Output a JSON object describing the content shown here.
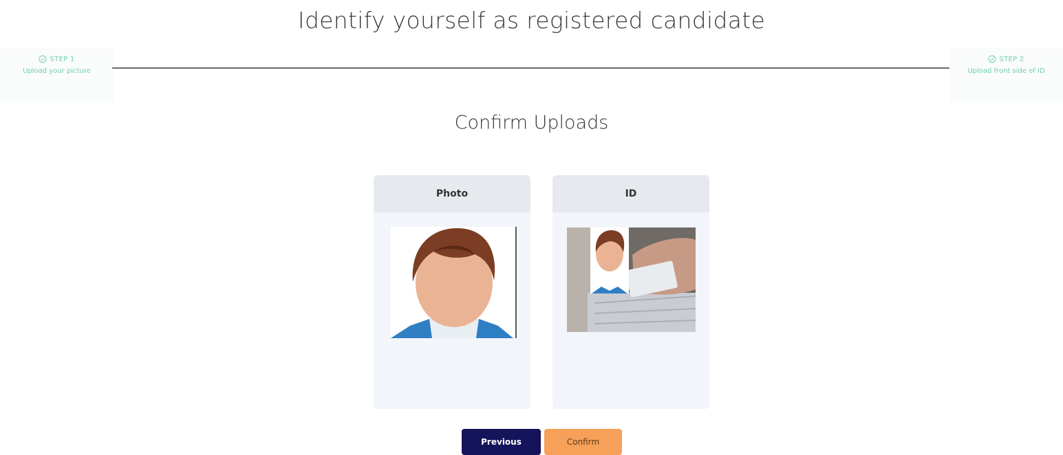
{
  "page": {
    "title": "Identify yourself as registered candidate"
  },
  "steps": [
    {
      "label": "STEP 1",
      "description": "Upload your picture",
      "status": "completed"
    },
    {
      "label": "STEP 2",
      "description": "Upload front side of ID",
      "status": "completed"
    }
  ],
  "confirm": {
    "title": "Confirm Uploads",
    "cards": [
      {
        "header": "Photo",
        "image": "avatar-placeholder"
      },
      {
        "header": "ID",
        "image": "id-card-photo"
      }
    ]
  },
  "actions": {
    "previous_label": "Previous",
    "confirm_label": "Confirm"
  },
  "colors": {
    "step_accent": "#6fcfb0",
    "previous_button": "#15135a",
    "confirm_button": "#f6a05a",
    "card_background": "#f2f5f9"
  },
  "icons": {
    "step_status": "check-circle-icon"
  }
}
